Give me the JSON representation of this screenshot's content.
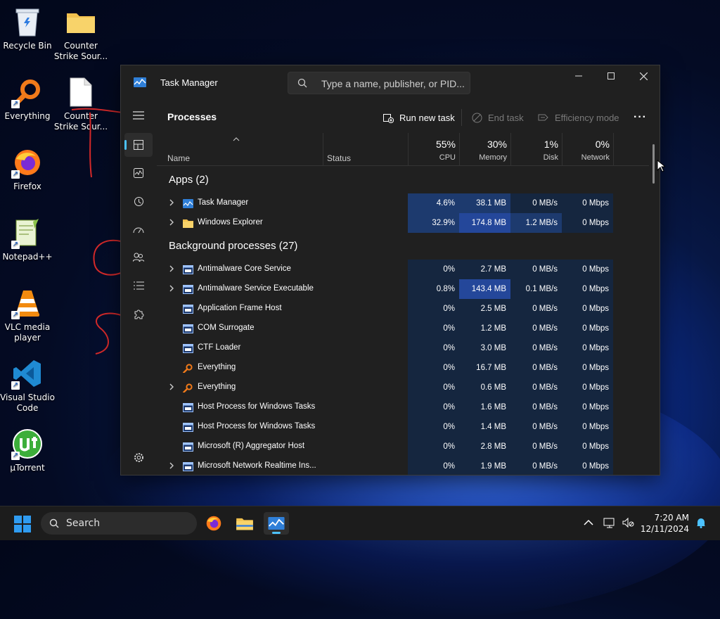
{
  "desktop": {
    "icons": [
      {
        "label": "Recycle Bin",
        "icon": "recycle-bin-icon"
      },
      {
        "label": "Counter Strike Sour...",
        "icon": "folder-icon"
      },
      {
        "label": "Everything",
        "icon": "everything-icon"
      },
      {
        "label": "Counter Strike Sour...",
        "icon": "file-icon"
      },
      {
        "label": "Firefox",
        "icon": "firefox-icon"
      },
      {
        "label": "Notepad++",
        "icon": "notepadpp-icon"
      },
      {
        "label": "VLC media player",
        "icon": "vlc-icon"
      },
      {
        "label": "Visual Studio Code",
        "icon": "vscode-icon"
      },
      {
        "label": "µTorrent",
        "icon": "utorrent-icon"
      }
    ]
  },
  "window": {
    "title": "Task Manager",
    "search_placeholder": "Type a name, publisher, or PID...",
    "controls": {
      "minimize": "—",
      "maximize": "☐",
      "close": "✕"
    }
  },
  "sidebar": {
    "items": [
      {
        "name": "hamburger-menu",
        "icon": "hamburger-icon"
      },
      {
        "name": "processes",
        "icon": "processes-icon",
        "active": true
      },
      {
        "name": "performance",
        "icon": "performance-icon"
      },
      {
        "name": "app-history",
        "icon": "history-icon"
      },
      {
        "name": "startup-apps",
        "icon": "speedometer-icon"
      },
      {
        "name": "users",
        "icon": "users-icon"
      },
      {
        "name": "details",
        "icon": "list-icon"
      },
      {
        "name": "services",
        "icon": "puzzle-icon"
      },
      {
        "name": "settings",
        "icon": "gear-icon"
      }
    ]
  },
  "page": {
    "title": "Processes",
    "run_new_task": "Run new task",
    "end_task": "End task",
    "efficiency_mode": "Efficiency mode",
    "more": "···"
  },
  "columns": {
    "name": "Name",
    "status": "Status",
    "cpu": {
      "pct": "55%",
      "label": "CPU"
    },
    "memory": {
      "pct": "30%",
      "label": "Memory"
    },
    "disk": {
      "pct": "1%",
      "label": "Disk"
    },
    "network": {
      "pct": "0%",
      "label": "Network"
    }
  },
  "groups": {
    "apps": "Apps (2)",
    "background": "Background processes (27)"
  },
  "apps": [
    {
      "name": "Task Manager",
      "icon": "taskmanager-icon",
      "expand": true,
      "cpu": "4.6%",
      "mem": "38.1 MB",
      "disk": "0 MB/s",
      "net": "0 Mbps"
    },
    {
      "name": "Windows Explorer",
      "icon": "folder-icon",
      "expand": true,
      "cpu": "32.9%",
      "mem": "174.8 MB",
      "disk": "1.2 MB/s",
      "net": "0 Mbps"
    }
  ],
  "background": [
    {
      "name": "Antimalware Core Service",
      "icon": "service-icon",
      "expand": true,
      "cpu": "0%",
      "mem": "2.7 MB",
      "disk": "0 MB/s",
      "net": "0 Mbps"
    },
    {
      "name": "Antimalware Service Executable",
      "icon": "service-icon",
      "expand": true,
      "cpu": "0.8%",
      "mem": "143.4 MB",
      "disk": "0.1 MB/s",
      "net": "0 Mbps"
    },
    {
      "name": "Application Frame Host",
      "icon": "service-icon",
      "expand": false,
      "cpu": "0%",
      "mem": "2.5 MB",
      "disk": "0 MB/s",
      "net": "0 Mbps"
    },
    {
      "name": "COM Surrogate",
      "icon": "service-icon",
      "expand": false,
      "cpu": "0%",
      "mem": "1.2 MB",
      "disk": "0 MB/s",
      "net": "0 Mbps"
    },
    {
      "name": "CTF Loader",
      "icon": "service-icon",
      "expand": false,
      "cpu": "0%",
      "mem": "3.0 MB",
      "disk": "0 MB/s",
      "net": "0 Mbps"
    },
    {
      "name": "Everything",
      "icon": "everything-icon",
      "expand": false,
      "cpu": "0%",
      "mem": "16.7 MB",
      "disk": "0 MB/s",
      "net": "0 Mbps"
    },
    {
      "name": "Everything",
      "icon": "everything-icon",
      "expand": true,
      "cpu": "0%",
      "mem": "0.6 MB",
      "disk": "0 MB/s",
      "net": "0 Mbps"
    },
    {
      "name": "Host Process for Windows Tasks",
      "icon": "service-icon",
      "expand": false,
      "cpu": "0%",
      "mem": "1.6 MB",
      "disk": "0 MB/s",
      "net": "0 Mbps"
    },
    {
      "name": "Host Process for Windows Tasks",
      "icon": "service-icon",
      "expand": false,
      "cpu": "0%",
      "mem": "1.4 MB",
      "disk": "0 MB/s",
      "net": "0 Mbps"
    },
    {
      "name": "Microsoft (R) Aggregator Host",
      "icon": "service-icon",
      "expand": false,
      "cpu": "0%",
      "mem": "2.8 MB",
      "disk": "0 MB/s",
      "net": "0 Mbps"
    },
    {
      "name": "Microsoft Network Realtime Ins...",
      "icon": "service-icon",
      "expand": true,
      "cpu": "0%",
      "mem": "1.9 MB",
      "disk": "0 MB/s",
      "net": "0 Mbps"
    }
  ],
  "taskbar": {
    "search": "Search",
    "apps": [
      "firefox-icon",
      "file-explorer-icon",
      "taskmanager-icon"
    ],
    "time": "7:20 AM",
    "date": "12/11/2024"
  },
  "colors": {
    "accent": "#4cc2ff",
    "heat_low": "#15263f",
    "heat_mid": "#1d3a6e",
    "heat_high": "#24479a"
  }
}
